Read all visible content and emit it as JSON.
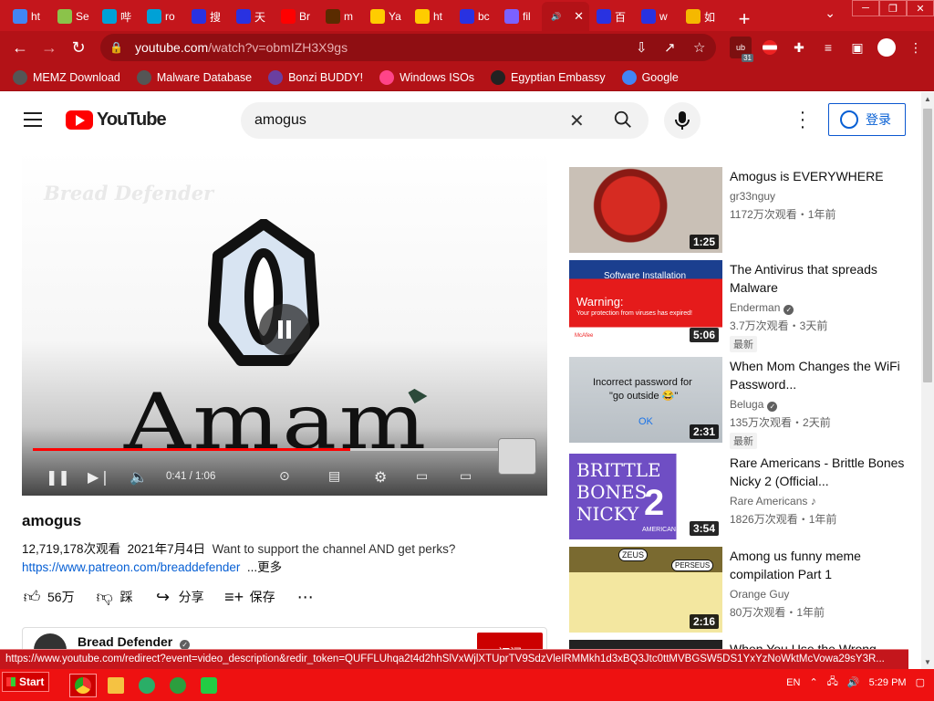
{
  "browser": {
    "tabs": [
      {
        "label": "ht",
        "icon": "google-icon",
        "color": "#4285f4"
      },
      {
        "label": "Se",
        "icon": "tag-icon",
        "color": "#8bc34a"
      },
      {
        "label": "哔",
        "icon": "bilibili-icon",
        "color": "#00a1d6"
      },
      {
        "label": "ro",
        "icon": "bilibili-icon",
        "color": "#00a1d6"
      },
      {
        "label": "搜",
        "icon": "baidu-icon",
        "color": "#2932e1"
      },
      {
        "label": "天",
        "icon": "baidu-icon",
        "color": "#2932e1"
      },
      {
        "label": "Br",
        "icon": "youtube-icon",
        "color": "#ff0000"
      },
      {
        "label": "m",
        "icon": "dark-icon",
        "color": "#5a2b00"
      },
      {
        "label": "Ya",
        "icon": "yandex-icon",
        "color": "#ffcc00"
      },
      {
        "label": "ht",
        "icon": "emoji-icon",
        "color": "#ffcc00"
      },
      {
        "label": "bc",
        "icon": "baidu-icon",
        "color": "#2932e1"
      },
      {
        "label": "fil",
        "icon": "document-icon",
        "color": "#7b61ff"
      },
      {
        "label": "",
        "icon": "speaker-icon",
        "color": "#ffffff",
        "active": true
      },
      {
        "label": "百",
        "icon": "baidu-icon",
        "color": "#2932e1"
      },
      {
        "label": "w",
        "icon": "baidu-icon",
        "color": "#2932e1"
      },
      {
        "label": "如",
        "icon": "s-icon",
        "color": "#f5b800"
      }
    ],
    "url_host": "youtube.com",
    "url_path": "/watch?v=obmIZH3X9gs",
    "ext_badge": "31",
    "bookmarks": [
      {
        "label": "MEMZ Download",
        "color": "#555555"
      },
      {
        "label": "Malware Database",
        "color": "#555555"
      },
      {
        "label": "Bonzi BUDDY!",
        "color": "#6b3fa0"
      },
      {
        "label": "Windows ISOs",
        "color": "#ff4488"
      },
      {
        "label": "Egyptian Embassy",
        "color": "#222222"
      },
      {
        "label": "Google",
        "color": "#4285f4"
      }
    ],
    "status_url": "https://www.youtube.com/redirect?event=video_description&redir_token=QUFFLUhqa2t4d2hhSlVxWjlXTUprTV9SdzVleIRMMkh1d3xBQ3Jtc0ttMVBGSW5DS1YxYzNoWktMcVowa29sY3R..."
  },
  "youtube": {
    "logo_text": "YouTube",
    "search_value": "amogus",
    "signin_label": "登录",
    "player": {
      "watermark": "Bread Defender",
      "frame_text": "Amam",
      "time": "0:41 / 1:06",
      "progress": 0.63
    },
    "video": {
      "title": "amogus",
      "views": "12,719,178次观看",
      "date": "2021年7月4日",
      "desc": "Want to support the channel AND get perks?",
      "link": "https://www.patreon.com/breaddefender",
      "more": "...更多",
      "likes": "56万",
      "dislike": "踩",
      "share": "分享",
      "save": "保存",
      "channel": "Bread Defender",
      "subscribe": "订阅"
    },
    "recommended": [
      {
        "title": "Amogus is EVERYWHERE",
        "channel": "gr33nguy",
        "views": "1172万次观看・1年前",
        "duration": "1:25",
        "verified": false,
        "new": ""
      },
      {
        "title": "The Antivirus that spreads Malware",
        "channel": "Enderman",
        "views": "3.7万次观看・3天前",
        "duration": "5:06",
        "verified": true,
        "new": "最新",
        "thumb_text": {
          "header": "Software Installation",
          "warning": "Warning:",
          "line": "Your protection from viruses has expired!",
          "brand": "McAfee"
        }
      },
      {
        "title": "When Mom Changes the WiFi Password...",
        "channel": "Beluga",
        "views": "135万次观看・2天前",
        "duration": "2:31",
        "verified": true,
        "new": "最新",
        "thumb_text": {
          "line1": "Incorrect password for",
          "line2": "\"go outside 😂\"",
          "ok": "OK"
        }
      },
      {
        "title": "Rare Americans - Brittle Bones Nicky 2 (Official...",
        "channel": "Rare Americans",
        "views": "1826万次观看・1年前",
        "duration": "3:54",
        "verified": false,
        "music": true,
        "new": "",
        "thumb_text": {
          "l1": "BRITTLE",
          "l2": "BONES",
          "l3": "NICKY",
          "num": "2",
          "brand": "AMERICANS"
        }
      },
      {
        "title": "Among us funny meme compilation Part 1",
        "channel": "Orange Guy",
        "views": "80万次观看・1年前",
        "duration": "2:16",
        "verified": false,
        "new": "",
        "thumb_text": {
          "a": "ZEUS",
          "b": "PERSEUS"
        }
      },
      {
        "title": "When You Use the Wrong",
        "channel": "",
        "views": "",
        "duration": "",
        "verified": false,
        "new": ""
      }
    ]
  },
  "taskbar": {
    "start_label": "Start",
    "lang": "EN",
    "clock": "5:29 PM"
  }
}
